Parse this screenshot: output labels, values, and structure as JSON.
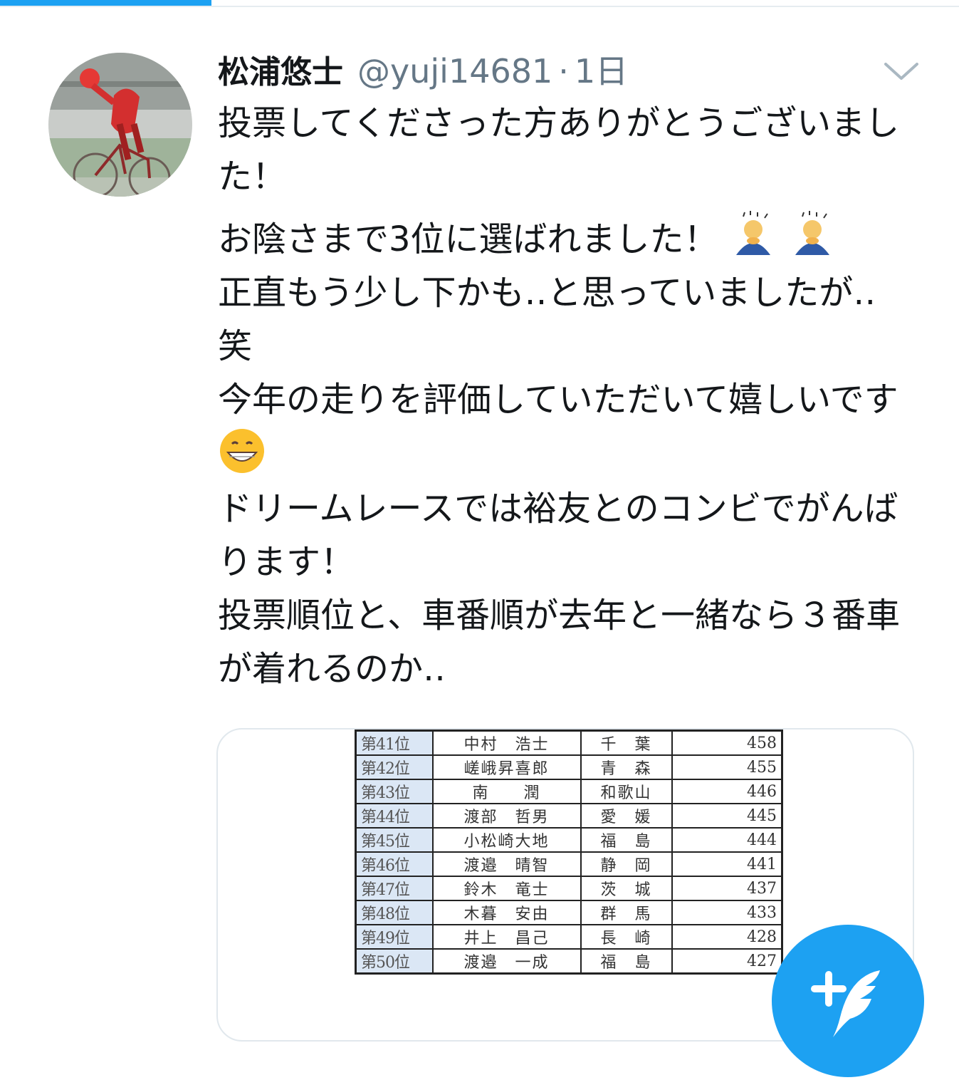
{
  "colors": {
    "accent": "#1da1f2",
    "text": "#14171a",
    "secondary": "#657786"
  },
  "tweet": {
    "display_name": "松浦悠士",
    "handle": "@yuji14681",
    "separator": "·",
    "time": "1日",
    "paragraphs": [
      "投票してくださった方ありがとうございました！",
      "お陰さまで3位に選ばれました！",
      "正直もう少し下かも‥と思っていましたが‥笑",
      "今年の走りを評価していただいて嬉しいです",
      "ドリームレースでは裕友とのコンビでがんばります！",
      "投票順位と、車番順が去年と一緒なら３番車が着れるのか‥"
    ],
    "emojis": [
      "bowing-person",
      "bowing-person",
      "grinning-face"
    ]
  },
  "media": {
    "rows": [
      {
        "rank": "第41位",
        "name": "中村　浩士",
        "pref": "千　葉",
        "votes": "458"
      },
      {
        "rank": "第42位",
        "name": "嵯峨昇喜郎",
        "pref": "青　森",
        "votes": "455"
      },
      {
        "rank": "第43位",
        "name": "南　　潤",
        "pref": "和歌山",
        "votes": "446"
      },
      {
        "rank": "第44位",
        "name": "渡部　哲男",
        "pref": "愛　媛",
        "votes": "445"
      },
      {
        "rank": "第45位",
        "name": "小松崎大地",
        "pref": "福　島",
        "votes": "444"
      },
      {
        "rank": "第46位",
        "name": "渡邉　晴智",
        "pref": "静　岡",
        "votes": "441"
      },
      {
        "rank": "第47位",
        "name": "鈴木　竜士",
        "pref": "茨　城",
        "votes": "437"
      },
      {
        "rank": "第48位",
        "name": "木暮　安由",
        "pref": "群　馬",
        "votes": "433"
      },
      {
        "rank": "第49位",
        "name": "井上　昌己",
        "pref": "長　崎",
        "votes": "428"
      },
      {
        "rank": "第50位",
        "name": "渡邉　一成",
        "pref": "福　島",
        "votes": "427"
      }
    ]
  },
  "fab": {
    "icon": "compose-tweet-icon"
  }
}
